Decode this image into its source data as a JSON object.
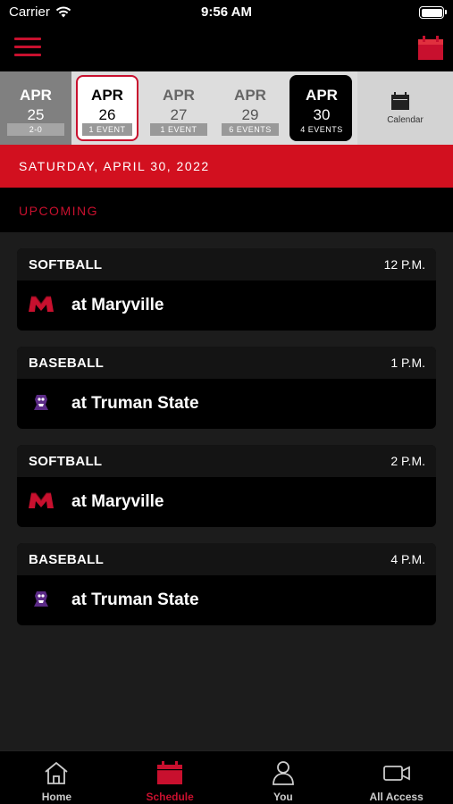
{
  "status_bar": {
    "carrier": "Carrier",
    "time": "9:56 AM"
  },
  "date_strip": {
    "days": [
      {
        "month": "APR",
        "day": "25",
        "badge": "2-0",
        "state": "past"
      },
      {
        "month": "APR",
        "day": "26",
        "badge": "1 EVENT",
        "state": "today"
      },
      {
        "month": "APR",
        "day": "27",
        "badge": "1 EVENT",
        "state": "default"
      },
      {
        "month": "APR",
        "day": "29",
        "badge": "6 EVENTS",
        "state": "default"
      },
      {
        "month": "APR",
        "day": "30",
        "badge": "4 EVENTS",
        "state": "selected"
      }
    ],
    "calendar_label": "Calendar"
  },
  "date_banner": "SATURDAY, APRIL 30, 2022",
  "section_label": "UPCOMING",
  "events": [
    {
      "sport": "SOFTBALL",
      "time": "12 P.M.",
      "opponent": "at Maryville",
      "logo": "maryville-m-logo"
    },
    {
      "sport": "BASEBALL",
      "time": "1 P.M.",
      "opponent": "at Truman State",
      "logo": "truman-bulldog-logo"
    },
    {
      "sport": "SOFTBALL",
      "time": "2 P.M.",
      "opponent": "at Maryville",
      "logo": "maryville-m-logo"
    },
    {
      "sport": "BASEBALL",
      "time": "4 P.M.",
      "opponent": "at Truman State",
      "logo": "truman-bulldog-logo"
    }
  ],
  "tab_bar": {
    "tabs": [
      {
        "label": "Home",
        "icon": "home-icon"
      },
      {
        "label": "Schedule",
        "icon": "calendar-icon",
        "active": true
      },
      {
        "label": "You",
        "icon": "person-icon"
      },
      {
        "label": "All Access",
        "icon": "video-camera-icon"
      }
    ]
  },
  "colors": {
    "accent": "#c8102e",
    "banner": "#d2101f",
    "background": "#1c1c1c"
  }
}
